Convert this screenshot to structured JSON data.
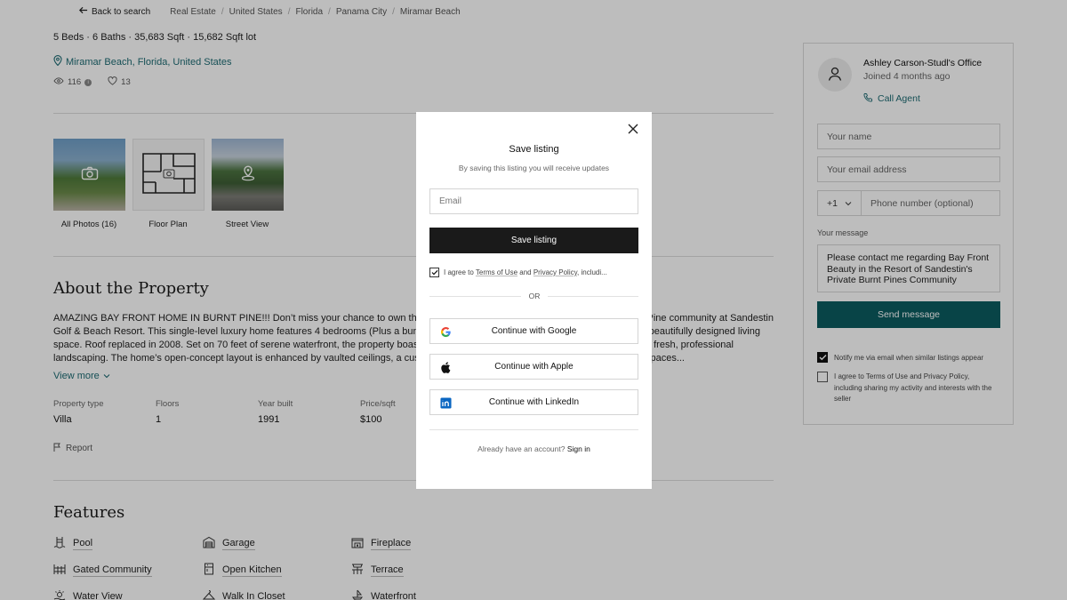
{
  "topbar": {
    "back_label": "Back to search",
    "breadcrumbs": [
      "Real Estate",
      "United States",
      "Florida",
      "Panama City",
      "Miramar Beach"
    ]
  },
  "summary": {
    "stats": "5 Beds · 6 Baths · 35,683 Sqft · 15,682 Sqft lot",
    "location": "Miramar Beach, Florida, United States",
    "views": "116",
    "likes": "13"
  },
  "media": [
    {
      "label": "All Photos (16)",
      "icon": "camera-icon"
    },
    {
      "label": "Floor Plan",
      "icon": "floor-plan-icon"
    },
    {
      "label": "Street View",
      "icon": "street-view-icon"
    }
  ],
  "about": {
    "title": "About the Property",
    "lines": [
      "AMAZING BAY FRONT HOME IN BURNT PINE!!! Don’t miss your chance to own this ext",
      "Golf & Beach Resort. This single-level luxury home features 4 bedrooms (Plus a bunkro",
      "space. Roof replaced in 2008. Set on 70 feet of serene waterfront, the property boasts",
      "landscaping. The home’s open-concept layout is enhanced by vaulted ceilings, a custo"
    ],
    "lines_right": [
      "Pine community at Sandestin",
      "beautifully designed living",
      "d fresh, professional",
      "paces..."
    ],
    "view_more": "View more"
  },
  "attributes": [
    {
      "label": "Property type",
      "value": "Villa"
    },
    {
      "label": "Floors",
      "value": "1"
    },
    {
      "label": "Year built",
      "value": "1991"
    },
    {
      "label": "Price/sqft",
      "value": "$100"
    }
  ],
  "report_label": "Report",
  "features": {
    "title": "Features",
    "items": [
      {
        "label": "Pool",
        "icon": "pool-icon"
      },
      {
        "label": "Garage",
        "icon": "garage-icon"
      },
      {
        "label": "Fireplace",
        "icon": "fireplace-icon"
      },
      {
        "label": "Gated Community",
        "icon": "gate-icon"
      },
      {
        "label": "Open Kitchen",
        "icon": "kitchen-icon"
      },
      {
        "label": "Terrace",
        "icon": "terrace-icon"
      },
      {
        "label": "Water View",
        "icon": "water-view-icon"
      },
      {
        "label": "Walk In Closet",
        "icon": "closet-icon"
      },
      {
        "label": "Waterfront",
        "icon": "waterfront-icon"
      }
    ]
  },
  "agent": {
    "name": "Ashley Carson-Studl's Office",
    "joined": "Joined 4 months ago",
    "call_label": "Call Agent",
    "name_placeholder": "Your name",
    "email_placeholder": "Your email address",
    "country_code": "+1",
    "phone_placeholder": "Phone number (optional)",
    "message_label": "Your message",
    "message_value": "Please contact me regarding Bay Front Beauty in the Resort of Sandestin's Private Burnt Pines Community",
    "send_label": "Send message",
    "notify_label": "Notify me via email when similar listings appear",
    "terms_label": "I agree to Terms of Use and Privacy Policy, including sharing my activity and interests with the seller"
  },
  "modal": {
    "title": "Save listing",
    "subtitle": "By saving this listing you will receive updates",
    "email_placeholder": "Email",
    "save_button": "Save listing",
    "agree_prefix": "I agree to ",
    "terms_link": "Terms of Use",
    "and": " and ",
    "privacy_link": "Privacy Policy",
    "agree_suffix": ", includi...",
    "or": "OR",
    "google": "Continue with Google",
    "apple": "Continue with Apple",
    "linkedin": "Continue with LinkedIn",
    "signin_prefix": "Already have an account? ",
    "signin_link": "Sign in"
  },
  "colors": {
    "accent": "#1d6b73",
    "send_button": "#0c5c61",
    "overlay": "rgba(0,0,0,0.26)"
  }
}
